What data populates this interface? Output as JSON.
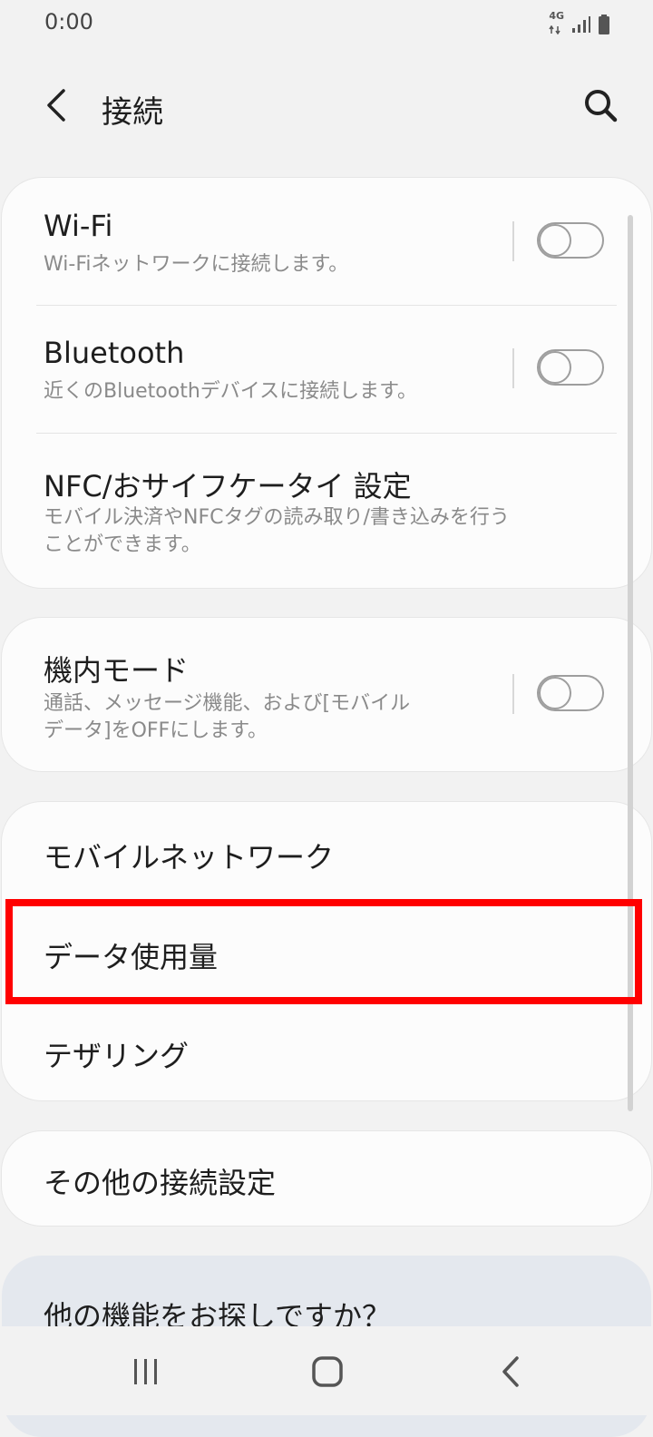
{
  "status_bar": {
    "time": "0:00",
    "network": "4G"
  },
  "header": {
    "title": "接続"
  },
  "connections": {
    "wifi": {
      "title": "Wi-Fi",
      "subtitle": "Wi-Fiネットワークに接続します。",
      "enabled": false
    },
    "bluetooth": {
      "title": "Bluetooth",
      "subtitle": "近くのBluetoothデバイスに接続します。",
      "enabled": false
    },
    "nfc": {
      "title": "NFC/おサイフケータイ 設定",
      "subtitle_line1": "モバイル決済やNFCタグの読み取り/書き込みを行う",
      "subtitle_line2": "ことができます。"
    }
  },
  "airplane": {
    "title": "機内モード",
    "subtitle_line1": "通話、メッセージ機能、および[モバイル",
    "subtitle_line2": "データ]をOFFにします。",
    "enabled": false
  },
  "network_group": {
    "mobile_network": "モバイルネットワーク",
    "data_usage": "データ使用量",
    "tethering": "テザリング"
  },
  "other": {
    "more_settings": "その他の接続設定"
  },
  "suggestion": {
    "text": "他の機能をお探しですか？"
  },
  "colors": {
    "highlight": "#ff0000",
    "card": "#fcfcfc",
    "background": "#f2f2f2",
    "suggestion_card": "#e4e8ee"
  }
}
